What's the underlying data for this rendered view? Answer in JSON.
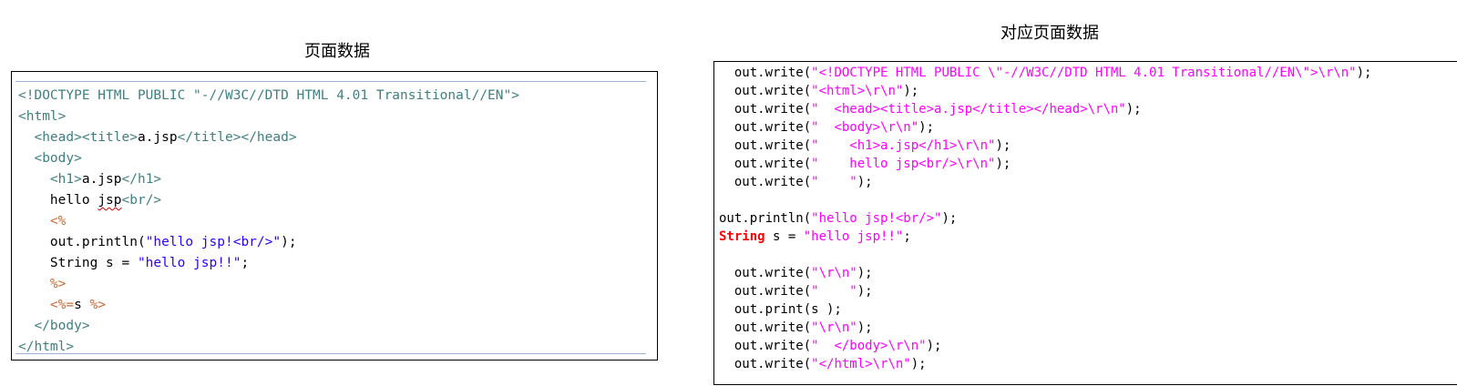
{
  "left": {
    "caption": "页面数据",
    "lines": [
      [
        {
          "c": "tag",
          "t": "<!DOCTYPE HTML PUBLIC \"-//W3C//DTD HTML 4.01 Transitional//EN\">"
        }
      ],
      [
        {
          "c": "tag",
          "t": "<html>"
        }
      ],
      [
        {
          "c": "blk",
          "t": "  "
        },
        {
          "c": "tag",
          "t": "<head><title>"
        },
        {
          "c": "blk",
          "t": "a.jsp"
        },
        {
          "c": "tag",
          "t": "</title></head>"
        }
      ],
      [
        {
          "c": "blk",
          "t": "  "
        },
        {
          "c": "tag",
          "t": "<body>"
        }
      ],
      [
        {
          "c": "blk",
          "t": "    "
        },
        {
          "c": "tag",
          "t": "<h1>"
        },
        {
          "c": "blk",
          "t": "a.jsp"
        },
        {
          "c": "tag",
          "t": "</h1>"
        }
      ],
      [
        {
          "c": "blk",
          "t": "    hello "
        },
        {
          "c": "blk squiggle",
          "t": "jsp"
        },
        {
          "c": "tag",
          "t": "<br/>"
        }
      ],
      [
        {
          "c": "blk",
          "t": "    "
        },
        {
          "c": "dir",
          "t": "<%"
        }
      ],
      [
        {
          "c": "blk",
          "t": "    out.println("
        },
        {
          "c": "str",
          "t": "\"hello jsp!<br/>\""
        },
        {
          "c": "blk",
          "t": ");"
        }
      ],
      [
        {
          "c": "blk",
          "t": "    String s = "
        },
        {
          "c": "str",
          "t": "\"hello jsp!!\""
        },
        {
          "c": "blk",
          "t": ";"
        }
      ],
      [
        {
          "c": "blk",
          "t": "    "
        },
        {
          "c": "dir",
          "t": "%>"
        }
      ],
      [
        {
          "c": "blk",
          "t": "    "
        },
        {
          "c": "dir",
          "t": "<%="
        },
        {
          "c": "blk",
          "t": "s "
        },
        {
          "c": "dir",
          "t": "%>"
        }
      ],
      [
        {
          "c": "blk",
          "t": "  "
        },
        {
          "c": "tag",
          "t": "</body>"
        }
      ],
      [
        {
          "c": "tag",
          "t": "</html>"
        }
      ]
    ]
  },
  "right": {
    "caption": "对应页面数据",
    "lines": [
      [
        {
          "c": "blk",
          "t": "  out.write("
        },
        {
          "c": "mag",
          "t": "\"<!DOCTYPE HTML PUBLIC \\\"-//W3C//DTD HTML 4.01 Transitional//EN\\\">\\r\\n\""
        },
        {
          "c": "blk",
          "t": ");"
        }
      ],
      [
        {
          "c": "blk",
          "t": "  out.write("
        },
        {
          "c": "mag",
          "t": "\"<html>\\r\\n\""
        },
        {
          "c": "blk",
          "t": ");"
        }
      ],
      [
        {
          "c": "blk",
          "t": "  out.write("
        },
        {
          "c": "mag",
          "t": "\"  <head><title>a.jsp</title></head>\\r\\n\""
        },
        {
          "c": "blk",
          "t": ");"
        }
      ],
      [
        {
          "c": "blk",
          "t": "  out.write("
        },
        {
          "c": "mag",
          "t": "\"  <body>\\r\\n\""
        },
        {
          "c": "blk",
          "t": ");"
        }
      ],
      [
        {
          "c": "blk",
          "t": "  out.write("
        },
        {
          "c": "mag",
          "t": "\"    <h1>a.jsp</h1>\\r\\n\""
        },
        {
          "c": "blk",
          "t": ");"
        }
      ],
      [
        {
          "c": "blk",
          "t": "  out.write("
        },
        {
          "c": "mag",
          "t": "\"    hello jsp<br/>\\r\\n\""
        },
        {
          "c": "blk",
          "t": ");"
        }
      ],
      [
        {
          "c": "blk",
          "t": "  out.write("
        },
        {
          "c": "mag",
          "t": "\"    \""
        },
        {
          "c": "blk",
          "t": ");"
        }
      ],
      [
        {
          "c": "blk",
          "t": ""
        }
      ],
      [
        {
          "c": "blk",
          "t": "out.println("
        },
        {
          "c": "mag",
          "t": "\"hello jsp!<br/>\""
        },
        {
          "c": "blk",
          "t": ");"
        }
      ],
      [
        {
          "c": "red",
          "t": "String"
        },
        {
          "c": "blk",
          "t": " s = "
        },
        {
          "c": "mag",
          "t": "\"hello jsp!!\""
        },
        {
          "c": "blk",
          "t": ";"
        }
      ],
      [
        {
          "c": "blk",
          "t": ""
        }
      ],
      [
        {
          "c": "blk",
          "t": "  out.write("
        },
        {
          "c": "mag",
          "t": "\"\\r\\n\""
        },
        {
          "c": "blk",
          "t": ");"
        }
      ],
      [
        {
          "c": "blk",
          "t": "  out.write("
        },
        {
          "c": "mag",
          "t": "\"    \""
        },
        {
          "c": "blk",
          "t": ");"
        }
      ],
      [
        {
          "c": "blk",
          "t": "  out.print(s );"
        }
      ],
      [
        {
          "c": "blk",
          "t": "  out.write("
        },
        {
          "c": "mag",
          "t": "\"\\r\\n\""
        },
        {
          "c": "blk",
          "t": ");"
        }
      ],
      [
        {
          "c": "blk",
          "t": "  out.write("
        },
        {
          "c": "mag",
          "t": "\"  </body>\\r\\n\""
        },
        {
          "c": "blk",
          "t": ");"
        }
      ],
      [
        {
          "c": "blk",
          "t": "  out.write("
        },
        {
          "c": "mag",
          "t": "\"</html>\\r\\n\""
        },
        {
          "c": "blk",
          "t": ");"
        }
      ]
    ]
  },
  "colors": {
    "tag": "#3f7f7f",
    "directive": "#cc6b3a",
    "string_left": "#2a00ff",
    "string_right": "#ff00ff",
    "keyword_right": "#ff0000"
  }
}
